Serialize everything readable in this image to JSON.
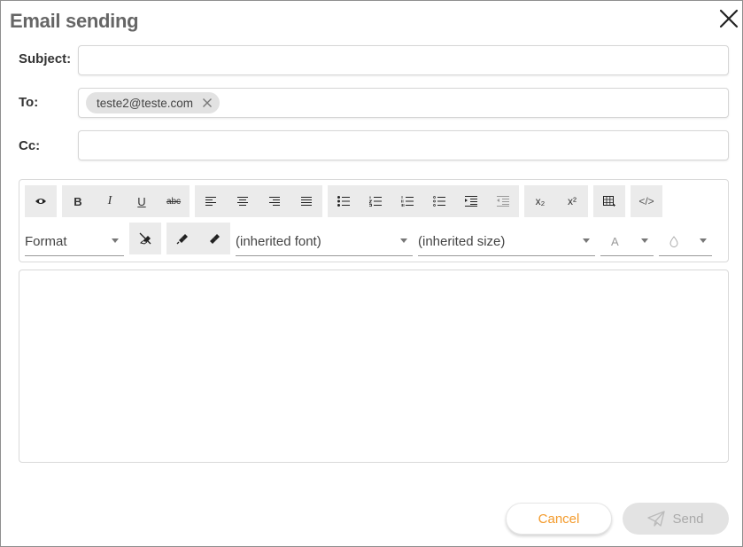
{
  "dialog": {
    "title": "Email sending"
  },
  "fields": {
    "subject_label": "Subject:",
    "subject_value": "",
    "to_label": "To:",
    "to_recipients": [
      "teste2@teste.com"
    ],
    "cc_label": "Cc:",
    "cc_value": ""
  },
  "toolbar": {
    "row1": [
      {
        "name": "preview",
        "icon": "eye-icon"
      },
      {
        "name": "bold",
        "label": "B"
      },
      {
        "name": "italic",
        "label": "I"
      },
      {
        "name": "underline",
        "label": "U"
      },
      {
        "name": "strikethrough",
        "label": "abc"
      },
      {
        "name": "align-left",
        "icon": "align-left-icon"
      },
      {
        "name": "align-center",
        "icon": "align-center-icon"
      },
      {
        "name": "align-right",
        "icon": "align-right-icon"
      },
      {
        "name": "align-justify",
        "icon": "align-justify-icon"
      },
      {
        "name": "bulleted-list",
        "icon": "bulleted-list-icon"
      },
      {
        "name": "numbered-list",
        "icon": "numbered-list-icon"
      },
      {
        "name": "roman-list",
        "icon": "roman-list-icon"
      },
      {
        "name": "lettered-list",
        "icon": "lettered-list-icon"
      },
      {
        "name": "indent",
        "icon": "indent-icon"
      },
      {
        "name": "outdent",
        "icon": "outdent-icon"
      },
      {
        "name": "subscript",
        "label": "x₂"
      },
      {
        "name": "superscript",
        "label": "x²"
      },
      {
        "name": "table",
        "icon": "table-icon"
      },
      {
        "name": "source",
        "label": "</>"
      }
    ],
    "format_label": "Format",
    "font_label": "(inherited font)",
    "size_label": "(inherited size)",
    "text_color_label": "A",
    "bg_color_icon": "droplet-icon"
  },
  "buttons": {
    "cancel": "Cancel",
    "send": "Send"
  },
  "colors": {
    "accent": "#f39a2b",
    "disabled_bg": "#e3e3e3",
    "disabled_text": "#aaaaaa",
    "toolbar_bg": "#ebebeb"
  }
}
